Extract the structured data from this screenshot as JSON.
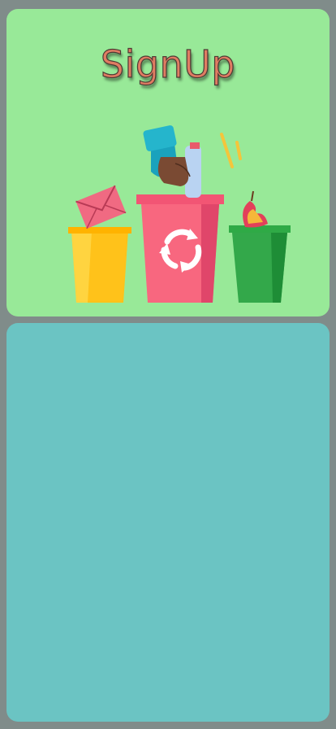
{
  "header": {
    "title": "SignUp"
  },
  "illustration": {
    "description_icon": "recycling-bins-icon"
  },
  "colors": {
    "background": "#808c8a",
    "top_card": "#98e998",
    "bottom_card": "#6bc4c3",
    "title": "#e07c62"
  }
}
